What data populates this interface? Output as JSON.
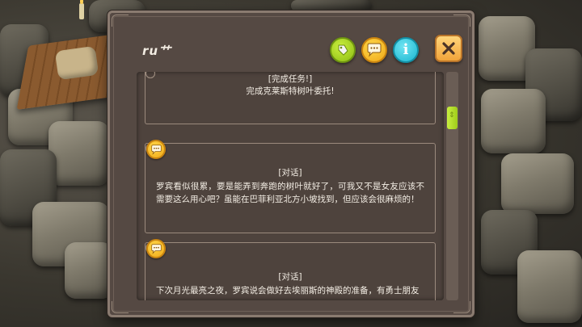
{
  "dialog": {
    "title": "ru艹",
    "header_buttons": [
      {
        "name": "quest-tag-button",
        "icon": "tag-icon",
        "color": "#a3d12a"
      },
      {
        "name": "dialogue-filter-button",
        "icon": "speech-bubble-icon",
        "color": "#f5be2a"
      },
      {
        "name": "info-button",
        "icon": "info-icon",
        "color": "#2cc5dc",
        "glyph": "i"
      }
    ],
    "close_icon": "close-icon"
  },
  "log_entries": [
    {
      "type": "quest",
      "icon": null,
      "header": "[完成任务!]",
      "text": "完成克莱斯特树叶委托!"
    },
    {
      "type": "dialogue",
      "icon": "speech-bubble-icon",
      "header": "[对话]",
      "text": "罗宾看似很累，要是能弄到奔跑的树叶就好了，可我又不是女友应该不需要这么用心吧？虽能在巴菲利亚北方小坡找到，但应该会很麻烦的！"
    },
    {
      "type": "dialogue",
      "icon": "speech-bubble-icon",
      "header": "[对话]",
      "text": "下次月光最亮之夜，罗宾说会做好去埃丽斯的神殿的准备，有勇士朋友"
    }
  ],
  "scrollbar": {
    "position": 0.17
  },
  "colors": {
    "accent_green": "#a3d12a",
    "accent_yellow": "#f5be2a",
    "accent_blue": "#2cc5dc",
    "panel": "#554943"
  }
}
